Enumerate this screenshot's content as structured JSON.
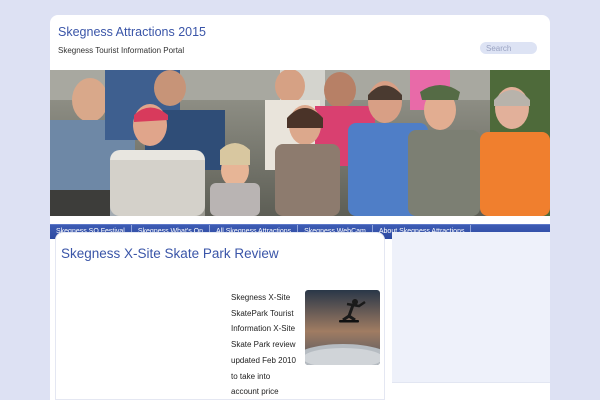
{
  "header": {
    "site_title": "Skegness Attractions 2015",
    "site_description": "Skegness Tourist Information Portal",
    "search_placeholder": "Search"
  },
  "nav": {
    "items": [
      {
        "label": "Skegness SO Festival"
      },
      {
        "label": "Skegness What's On"
      },
      {
        "label": "All Skegness Attractions"
      },
      {
        "label": "Skegness WebCam"
      },
      {
        "label": "About Skegness Attractions"
      }
    ]
  },
  "post": {
    "title": "Skegness X-Site Skate Park Review",
    "excerpt": "Skegness X-Site SkatePark Tourist Information X-Site Skate Park review updated Feb 2010 to take into account price"
  },
  "colors": {
    "background": "#dde1f3",
    "title_blue": "#3a55a8",
    "nav_blue": "#2d49a0"
  }
}
